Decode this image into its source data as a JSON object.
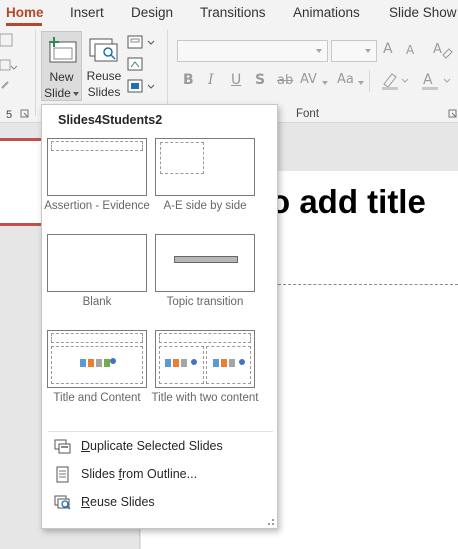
{
  "ribbon": {
    "tabs": [
      {
        "label": "Home",
        "active": true
      },
      {
        "label": "Insert",
        "active": false
      },
      {
        "label": "Design",
        "active": false
      },
      {
        "label": "Transitions",
        "active": false
      },
      {
        "label": "Animations",
        "active": false
      },
      {
        "label": "Slide Show",
        "active": false
      }
    ],
    "new_slide": {
      "line1": "New",
      "line2": "Slide"
    },
    "reuse_slides": {
      "line1": "Reuse",
      "line2": "Slides"
    },
    "font_group_label": "Font",
    "font_buttons": [
      "B",
      "I",
      "U",
      "S",
      "ab",
      "AV",
      "Aa"
    ],
    "size_buttons": [
      "A",
      "A"
    ]
  },
  "slide": {
    "title_placeholder": "o add title"
  },
  "dropdown": {
    "heading": "Slides4Students2",
    "layouts": [
      {
        "caption": "Assertion - Evidence"
      },
      {
        "caption": "A-E side by side"
      },
      {
        "caption": "Blank"
      },
      {
        "caption": "Topic transition"
      },
      {
        "caption": "Title and Content"
      },
      {
        "caption": "Title with two content"
      }
    ],
    "commands": [
      {
        "label": "Duplicate Selected Slides",
        "icon": "duplicate-slides-icon"
      },
      {
        "label": "Slides from Outline...",
        "icon": "outline-icon"
      },
      {
        "label": "Reuse Slides",
        "icon": "reuse-slides-icon"
      }
    ]
  },
  "colors": {
    "accent": "#b7472a",
    "theme_red": "#c0504d"
  }
}
